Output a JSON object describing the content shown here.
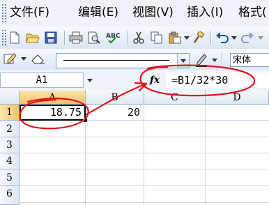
{
  "menu": {
    "items": [
      {
        "label": "文件(F)"
      },
      {
        "label": "编辑(E)"
      },
      {
        "label": "视图(V)"
      },
      {
        "label": "插入(I)"
      },
      {
        "label": "格式("
      }
    ]
  },
  "toolbar": {
    "icons": [
      "new-document-icon",
      "open-folder-icon",
      "save-icon",
      "print-icon",
      "print-preview-icon",
      "spelling-icon",
      "cut-icon",
      "copy-icon",
      "paste-icon",
      "format-painter-icon",
      "undo-icon",
      "redo-icon"
    ]
  },
  "drawing_toolbar": {
    "font_name": "宋体"
  },
  "formula_bar": {
    "name_box": "A1",
    "fx_label": "fx",
    "formula": "=B1/32*30"
  },
  "sheet": {
    "columns": [
      "A",
      "B",
      "C",
      "D"
    ],
    "rows": [
      "1",
      "2",
      "3",
      "4",
      "5",
      "6"
    ],
    "cells": {
      "A1": "18.75",
      "B1": "20"
    },
    "active_cell": "A1"
  },
  "colors": {
    "annotation": "#e0141e",
    "header_selected": "#f5c46b",
    "chrome": "#dbe6f4"
  }
}
